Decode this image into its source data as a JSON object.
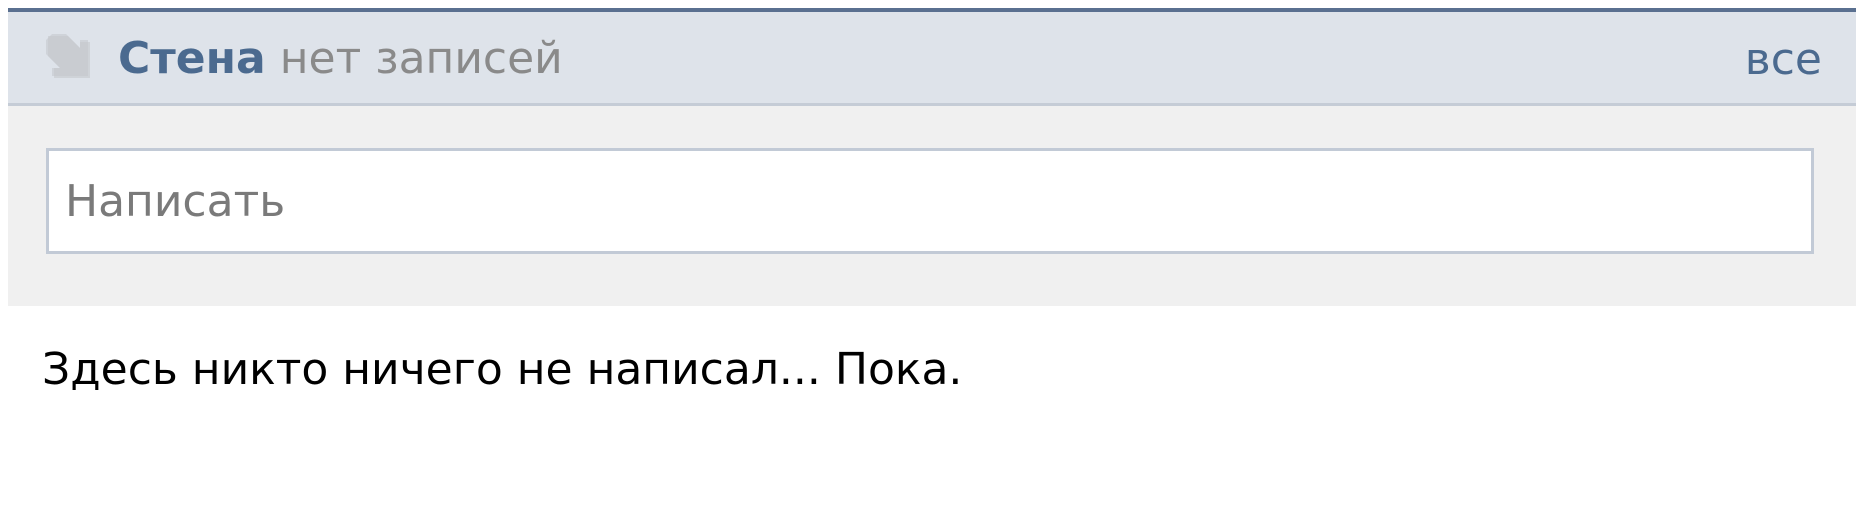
{
  "header": {
    "title": "Стена",
    "subtitle": "нет записей",
    "all_link": "все",
    "icon": "arrow-down-right-icon"
  },
  "compose": {
    "placeholder": "Написать"
  },
  "empty_message": "Здесь никто ничего не написал... Пока.",
  "colors": {
    "accent_line": "#5a7090",
    "header_bg": "#dee3ea",
    "title": "#4b6a8f",
    "subtitle": "#8a8a8a",
    "compose_bg": "#f0f0f0",
    "input_border": "#c2cad6"
  }
}
